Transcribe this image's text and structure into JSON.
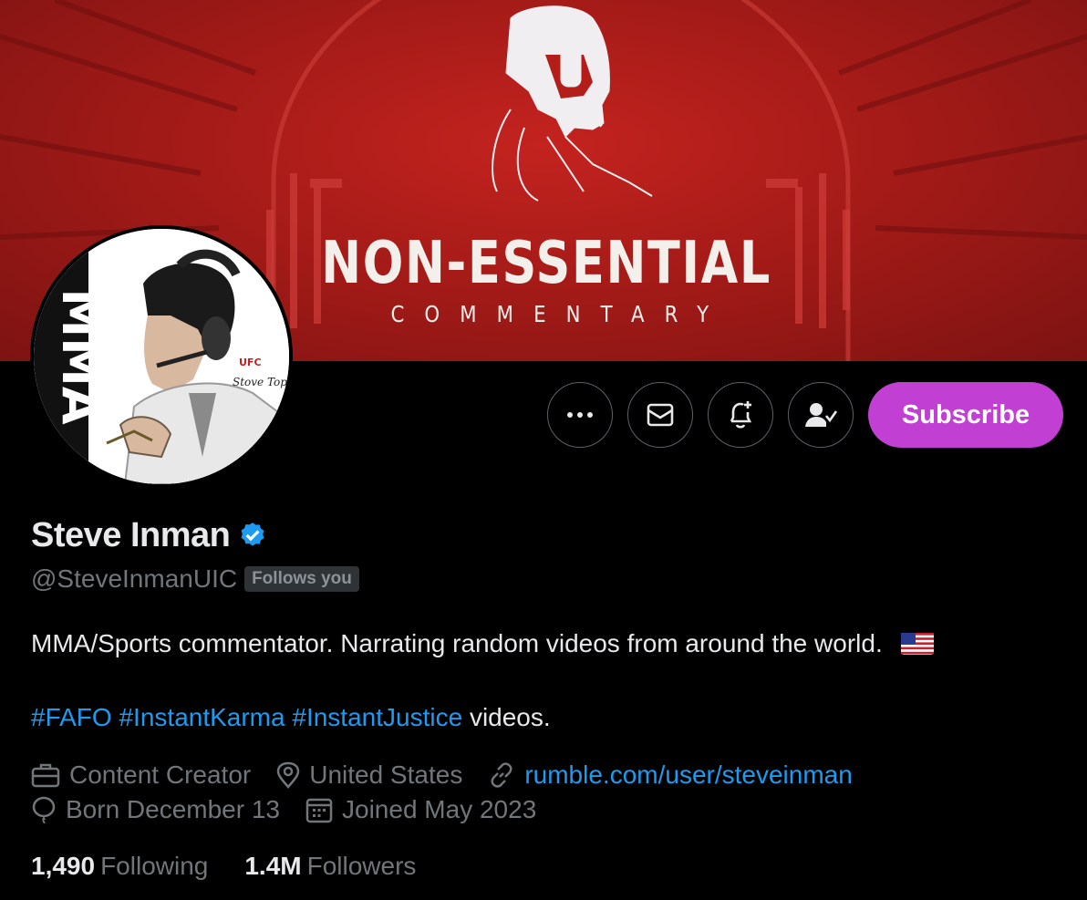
{
  "banner": {
    "title": "NON-ESSENTIAL",
    "subtitle": "COMMENTARY"
  },
  "avatar": {
    "icon": "commentator-avatar",
    "logo_text": "MMA",
    "patch_text_1": "UFC",
    "patch_text_2": "Stove Top"
  },
  "actions": {
    "more_icon": "more-icon",
    "message_icon": "mail-icon",
    "notify_icon": "bell-plus-icon",
    "following_icon": "person-check-icon",
    "subscribe_label": "Subscribe",
    "subscribe_color": "#c13fd2"
  },
  "profile": {
    "display_name": "Steve Inman",
    "handle": "@SteveInmanUIC",
    "follows_you": "Follows you",
    "bio_line1": "MMA/Sports commentator.  Narrating random videos from around the world.",
    "hashtags": [
      "#FAFO",
      "#InstantKarma",
      "#InstantJustice"
    ],
    "bio_line2_suffix": "videos.",
    "category": "Content Creator",
    "location": "United States",
    "website": "rumble.com/user/steveinman",
    "birthday": "Born December 13",
    "joined": "Joined May 2023"
  },
  "stats": {
    "following_count": "1,490",
    "following_label": "Following",
    "followers_count": "1.4M",
    "followers_label": "Followers"
  },
  "colors": {
    "accent": "#1d9bf0",
    "verified": "#1d9bf0",
    "banner_red": "#a51b18"
  }
}
